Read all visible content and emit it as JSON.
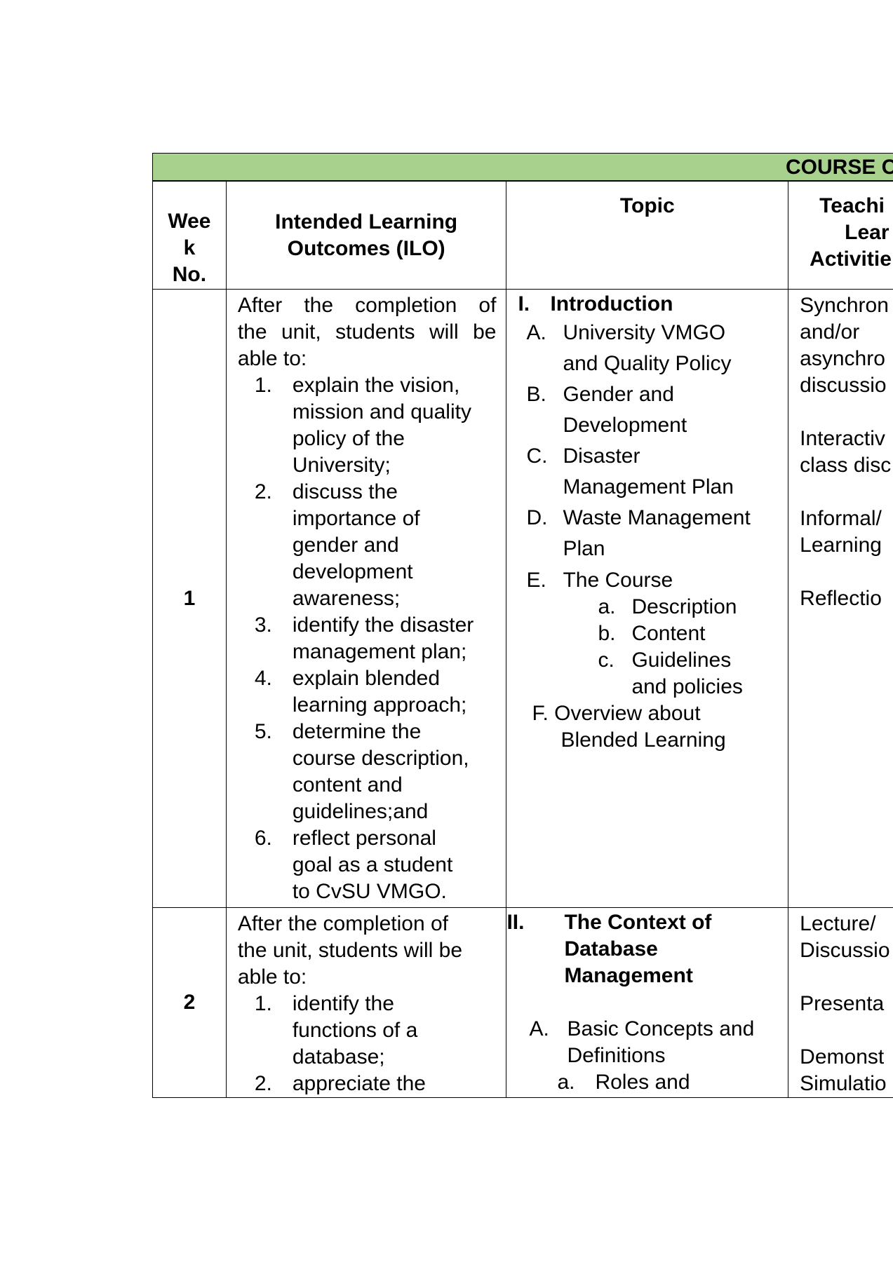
{
  "table_title": "COURSE C",
  "headers": {
    "week": [
      "Wee",
      "k",
      "No."
    ],
    "ilo": [
      "Intended Learning",
      "Outcomes (ILO)"
    ],
    "topic": "Topic",
    "tla": [
      "Teachi",
      "Lear",
      "Activitie"
    ]
  },
  "rows": [
    {
      "week": "1",
      "ilo_intro": [
        "After the completion of",
        "the unit, students will be",
        "able to:"
      ],
      "ilo_items": [
        {
          "num": "1.",
          "lines": [
            "explain the vision,",
            "mission and quality",
            "policy of the",
            "University;"
          ]
        },
        {
          "num": "2.",
          "lines": [
            "discuss the",
            "importance of",
            "gender and",
            "development",
            "awareness;"
          ]
        },
        {
          "num": "3.",
          "lines": [
            "identify the disaster",
            "management plan;"
          ]
        },
        {
          "num": "4.",
          "lines": [
            "explain blended",
            "learning approach;"
          ]
        },
        {
          "num": "5.",
          "lines": [
            "determine the",
            "course description,",
            "content and",
            "guidelines;and"
          ]
        },
        {
          "num": "6.",
          "lines": [
            "reflect personal",
            "goal as a student",
            "to CvSU VMGO."
          ]
        }
      ],
      "topic_heading_num": "I.",
      "topic_heading": "Introduction",
      "topics": [
        {
          "ltr": "A.",
          "lines": [
            "University VMGO",
            "and Quality Policy"
          ]
        },
        {
          "ltr": "B.",
          "lines": [
            "Gender and",
            "Development"
          ]
        },
        {
          "ltr": "C.",
          "lines": [
            "Disaster",
            "Management Plan"
          ]
        },
        {
          "ltr": "D.",
          "lines": [
            "Waste Management",
            "Plan"
          ]
        },
        {
          "ltr": "E.",
          "lines": [
            "The Course"
          ]
        }
      ],
      "subtopics": [
        {
          "ltr": "a.",
          "lines": [
            "Description"
          ]
        },
        {
          "ltr": "b.",
          "lines": [
            "Content"
          ]
        },
        {
          "ltr": "c.",
          "lines": [
            "Guidelines",
            "and policies"
          ]
        }
      ],
      "topic_f": [
        "F. Overview about",
        "Blended Learning"
      ],
      "tla": [
        "Synchron",
        "and/or",
        "asynchro",
        "discussio",
        "",
        "Interactiv",
        "class disc",
        "",
        "Informal/",
        "Learning",
        "",
        "Reflectio"
      ]
    },
    {
      "week": "2",
      "ilo_intro": [
        "After the completion of",
        "the unit, students will be",
        "able to:"
      ],
      "ilo_items": [
        {
          "num": "1.",
          "lines": [
            "identify the",
            "functions of a",
            "database;"
          ]
        },
        {
          "num": "2.",
          "lines": [
            "appreciate the"
          ]
        }
      ],
      "topic_heading_num": "II.",
      "topic_heading_lines": [
        "The Context of",
        "Database",
        "Management"
      ],
      "topic_a": {
        "ltr": "A.",
        "lines": [
          "Basic Concepts and",
          "Definitions"
        ]
      },
      "topic_a_sub": {
        "ltr": "a.",
        "text": "Roles and"
      },
      "tla": [
        "Lecture/",
        "Discussio",
        "",
        "Presenta",
        "",
        "Demonst",
        "Simulatio"
      ]
    }
  ]
}
